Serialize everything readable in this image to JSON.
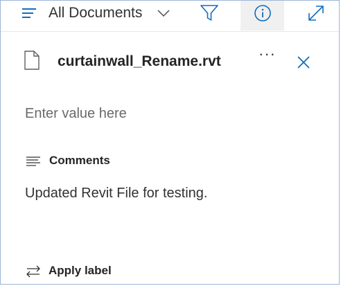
{
  "header": {
    "view_label": "All Documents",
    "icons": [
      "hamburger-icon",
      "chevron-down-icon",
      "filter-icon",
      "info-icon",
      "expand-icon"
    ],
    "accent": "#0f6cbd"
  },
  "file": {
    "name": "curtainwall_Rename.rvt",
    "more_label": "···",
    "icon": "document-icon"
  },
  "field": {
    "placeholder": "Enter value here"
  },
  "comments": {
    "title": "Comments",
    "text": "Updated Revit File for testing."
  },
  "footer": {
    "apply_label": "Apply label"
  }
}
